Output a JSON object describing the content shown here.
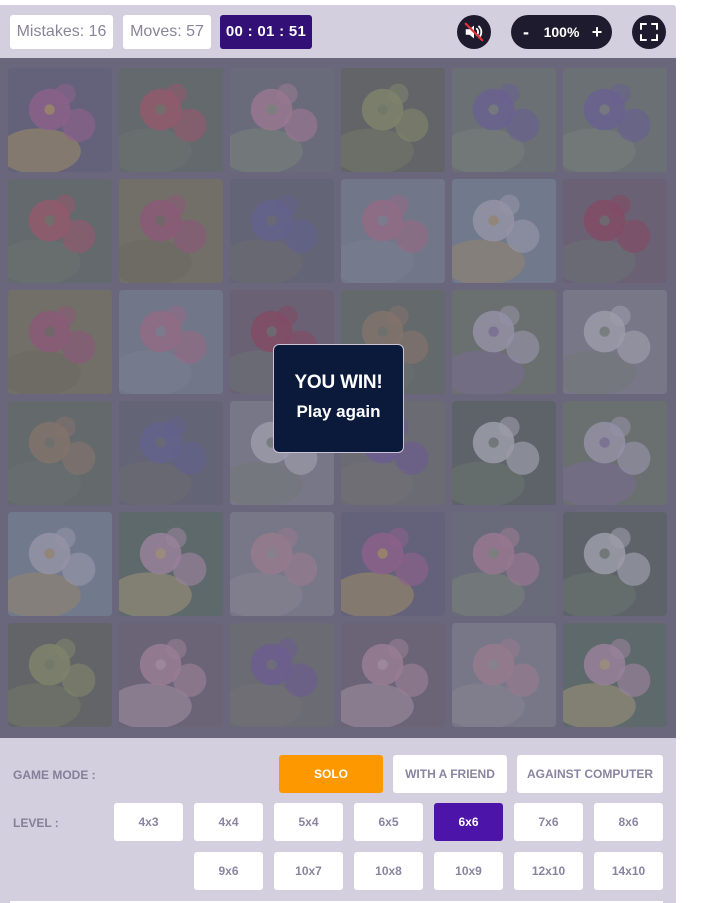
{
  "header": {
    "mistakes_label": "Mistakes: 16",
    "moves_label": "Moves: 57",
    "timer": "00 : 01 : 51",
    "mute_icon": "speaker-muted-icon",
    "zoom": {
      "minus": "-",
      "value": "100%",
      "plus": "+"
    },
    "fullscreen_icon": "fullscreen-icon"
  },
  "board": {
    "grid": "6x6",
    "tiles": [
      [
        {
          "flower": "pink water lily",
          "colors": [
            "#5d5a7a",
            "#b45a9a",
            "#d4b34a"
          ]
        },
        {
          "flower": "red geranium",
          "colors": [
            "#5c6a5a",
            "#c24a58",
            "#6e7f5e"
          ]
        },
        {
          "flower": "pink lotus pond",
          "colors": [
            "#6a7078",
            "#d08aaa",
            "#8aa07a"
          ]
        },
        {
          "flower": "green chrysanthemum",
          "colors": [
            "#59604e",
            "#98a458",
            "#7d8a4f"
          ]
        },
        {
          "flower": "purple lupine",
          "colors": [
            "#6a7a6a",
            "#6a58a8",
            "#8a9a78"
          ]
        },
        {
          "flower": "purple lupine",
          "colors": [
            "#6a7a6a",
            "#6a58a8",
            "#8a9a78"
          ]
        }
      ],
      [
        {
          "flower": "red geranium",
          "colors": [
            "#5c6a5a",
            "#c24a58",
            "#6e7f5e"
          ]
        },
        {
          "flower": "bleeding heart",
          "colors": [
            "#7a7850",
            "#b24a72",
            "#6e6a48"
          ]
        },
        {
          "flower": "blue delphinium",
          "colors": [
            "#5c6070",
            "#5a5aa0",
            "#6a7060"
          ]
        },
        {
          "flower": "pink roses",
          "colors": [
            "#7a8898",
            "#c0708e",
            "#8a98a8"
          ]
        },
        {
          "flower": "daisies",
          "colors": [
            "#7a90a0",
            "#c8c8d8",
            "#c4a460"
          ]
        },
        {
          "flower": "red roses",
          "colors": [
            "#6a5a6a",
            "#a02a48",
            "#6a7a6a"
          ]
        }
      ],
      [
        {
          "flower": "bleeding heart",
          "colors": [
            "#7a7850",
            "#b24a72",
            "#6e6a48"
          ]
        },
        {
          "flower": "pink roses",
          "colors": [
            "#7a8898",
            "#c0708e",
            "#8a98a8"
          ]
        },
        {
          "flower": "red roses",
          "colors": [
            "#6a5a6a",
            "#a02a48",
            "#6a7a6a"
          ]
        },
        {
          "flower": "pine cone ginger",
          "colors": [
            "#5e6a5a",
            "#a08058",
            "#6a7a60"
          ]
        },
        {
          "flower": "passion flower",
          "colors": [
            "#6a7a60",
            "#c8c0d8",
            "#8a70a8"
          ]
        },
        {
          "flower": "snowdrops",
          "colors": [
            "#8a8a98",
            "#d8d8e0",
            "#7a8a70"
          ]
        }
      ],
      [
        {
          "flower": "pine cone ginger",
          "colors": [
            "#5e6a5a",
            "#a08058",
            "#6a7a60"
          ]
        },
        {
          "flower": "blue delphinium",
          "colors": [
            "#5c6070",
            "#5a5aa0",
            "#6a7060"
          ]
        },
        {
          "flower": "snowdrops",
          "colors": [
            "#8a8a98",
            "#d8d8e0",
            "#7a8a70"
          ]
        },
        {
          "flower": "purple agapanthus",
          "colors": [
            "#6a7068",
            "#7050a8",
            "#7a7a70"
          ]
        },
        {
          "flower": "lily of the valley",
          "colors": [
            "#4e5e50",
            "#d8dce0",
            "#6a7e60"
          ]
        },
        {
          "flower": "passion flower",
          "colors": [
            "#6a7a60",
            "#c8c0d8",
            "#8a70a8"
          ]
        }
      ],
      [
        {
          "flower": "daisies",
          "colors": [
            "#7a90a0",
            "#c8c8d8",
            "#c4a460"
          ]
        },
        {
          "flower": "frangipani",
          "colors": [
            "#4e6a58",
            "#d0a0c0",
            "#d8c070"
          ]
        },
        {
          "flower": "pink cosmos",
          "colors": [
            "#8a8a98",
            "#c890a0",
            "#a8a0a8"
          ]
        },
        {
          "flower": "pink water lily",
          "colors": [
            "#5d5a7a",
            "#b45a9a",
            "#d4b34a"
          ]
        },
        {
          "flower": "pink lotus pond",
          "colors": [
            "#6a7078",
            "#d08aaa",
            "#8aa07a"
          ]
        },
        {
          "flower": "lily of the valley",
          "colors": [
            "#4e5e50",
            "#d8dce0",
            "#6a7e60"
          ]
        }
      ],
      [
        {
          "flower": "green chrysanthemum",
          "colors": [
            "#59604e",
            "#98a458",
            "#7d8a4f"
          ]
        },
        {
          "flower": "pink camellia",
          "colors": [
            "#6a6070",
            "#d098b0",
            "#e0b8c8"
          ]
        },
        {
          "flower": "purple agapanthus",
          "colors": [
            "#6a7068",
            "#7050a8",
            "#7a7a70"
          ]
        },
        {
          "flower": "pink camellia",
          "colors": [
            "#6a6070",
            "#d098b0",
            "#e0b8c8"
          ]
        },
        {
          "flower": "pink cosmos",
          "colors": [
            "#8a8a98",
            "#c890a0",
            "#a8a0a8"
          ]
        },
        {
          "flower": "frangipani",
          "colors": [
            "#4e6a58",
            "#d0a0c0",
            "#d8c070"
          ]
        }
      ]
    ]
  },
  "modal": {
    "title": "YOU WIN!",
    "action": "Play again"
  },
  "footer": {
    "game_mode_label": "GAME MODE :",
    "modes": [
      {
        "label": "SOLO",
        "selected": true
      },
      {
        "label": "WITH A FRIEND",
        "selected": false
      },
      {
        "label": "AGAINST COMPUTER",
        "selected": false
      }
    ],
    "level_label": "LEVEL :",
    "levels": [
      {
        "label": "4x3",
        "selected": false
      },
      {
        "label": "4x4",
        "selected": false
      },
      {
        "label": "5x4",
        "selected": false
      },
      {
        "label": "6x5",
        "selected": false
      },
      {
        "label": "6x6",
        "selected": true
      },
      {
        "label": "7x6",
        "selected": false
      },
      {
        "label": "8x6",
        "selected": false
      },
      {
        "label": "9x6",
        "selected": false
      },
      {
        "label": "10x7",
        "selected": false
      },
      {
        "label": "10x8",
        "selected": false
      },
      {
        "label": "10x9",
        "selected": false
      },
      {
        "label": "12x10",
        "selected": false
      },
      {
        "label": "14x10",
        "selected": false
      }
    ]
  },
  "colors": {
    "panel_bg": "#d3cfdf",
    "timer_bg": "#331076",
    "solo_accent": "#fe9800",
    "level_active": "#4d14a9",
    "modal_bg": "#0b1a3a",
    "control_bg": "#1e1b2e"
  }
}
